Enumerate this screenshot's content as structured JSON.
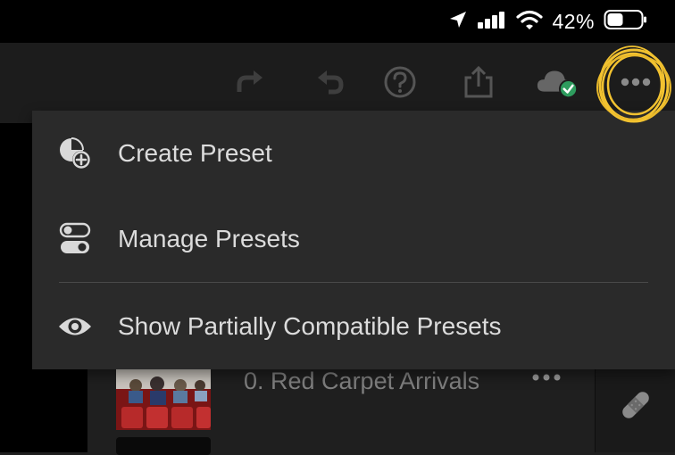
{
  "status_bar": {
    "battery_percent": "42%",
    "icons": [
      "location-arrow-icon",
      "cellular-signal-icon",
      "wifi-icon",
      "battery-icon"
    ]
  },
  "toolbar": {
    "icons": [
      "redo-icon",
      "undo-icon",
      "help-icon",
      "share-icon",
      "cloud-synced-icon",
      "more-options-icon"
    ]
  },
  "menu": {
    "items": [
      {
        "label": "Create Preset",
        "icon": "create-preset-icon"
      },
      {
        "label": "Manage Presets",
        "icon": "manage-presets-toggle-icon"
      },
      {
        "label": "Show Partially Compatible Presets",
        "icon": "eye-icon"
      }
    ]
  },
  "preset_list": {
    "items": [
      {
        "name": "0. Red Carpet Arrivals"
      }
    ]
  },
  "colors": {
    "accent_highlight": "#f2c230",
    "cloud_check": "#2e9c5e",
    "menu_bg": "#2a2a2a"
  }
}
